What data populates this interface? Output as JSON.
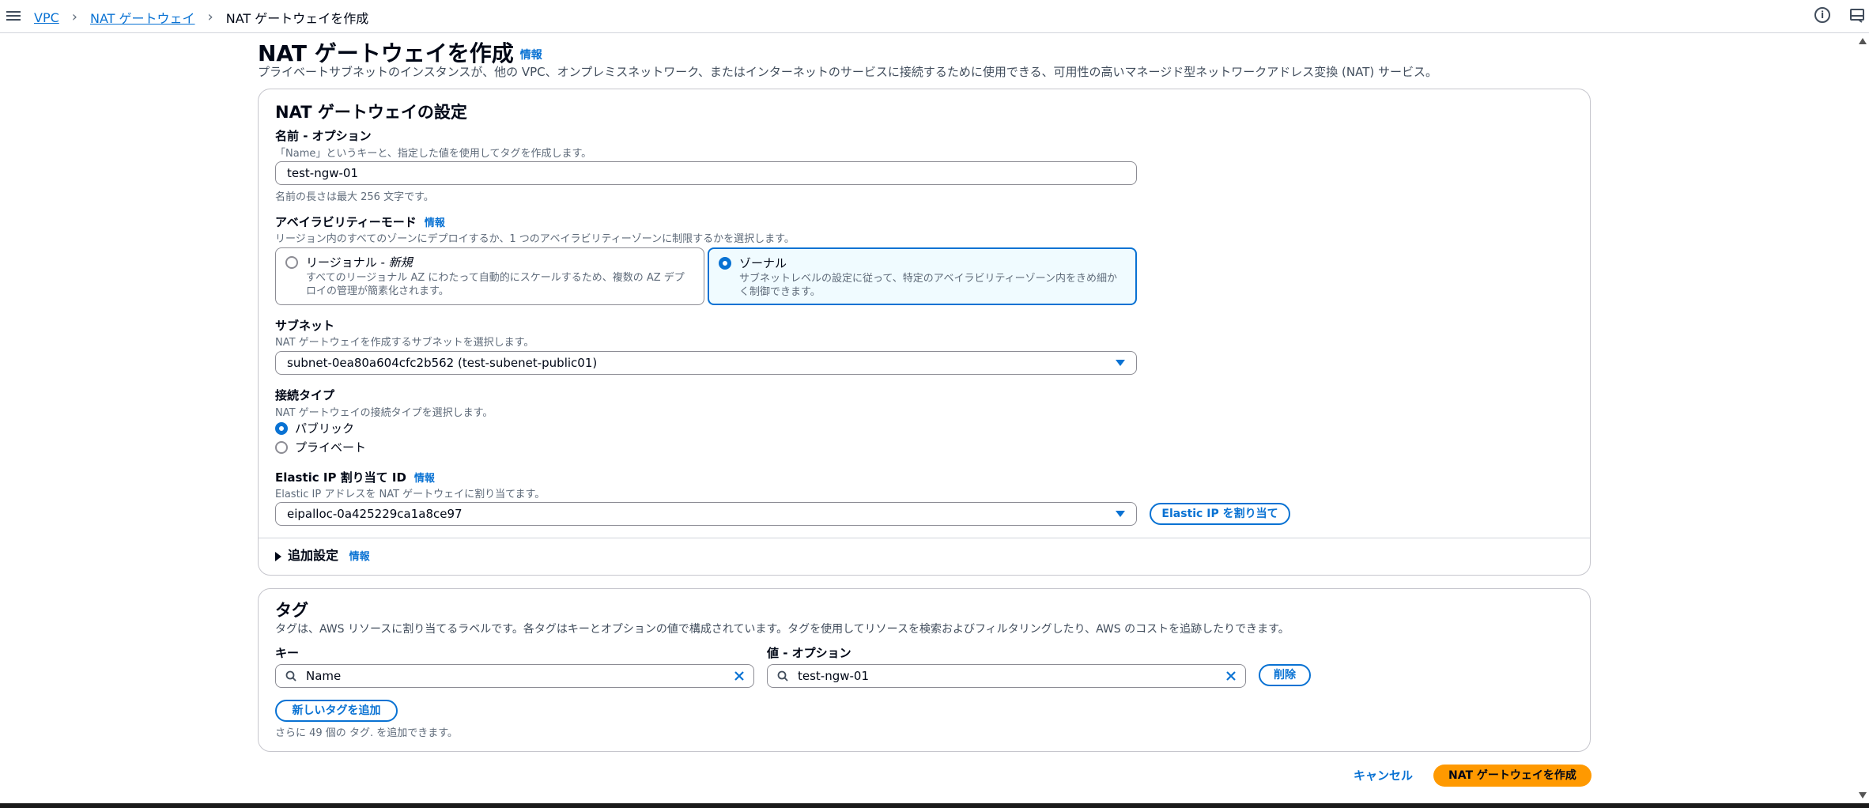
{
  "breadcrumb": {
    "items": [
      "VPC",
      "NAT ゲートウェイ"
    ],
    "current": "NAT ゲートウェイを作成"
  },
  "page": {
    "title": "NAT ゲートウェイを作成",
    "info_label": "情報",
    "description": "プライベートサブネットのインスタンスが、他の VPC、オンプレミスネットワーク、またはインターネットのサービスに接続するために使用できる、可用性の高いマネージド型ネットワークアドレス変換 (NAT) サービス。"
  },
  "settings": {
    "title": "NAT ゲートウェイの設定",
    "name": {
      "label": "名前 - オプション",
      "hint": "「Name」というキーと、指定した値を使用してタグを作成します。",
      "value": "test-ngw-01",
      "constraint": "名前の長さは最大 256 文字です。"
    },
    "availability": {
      "label": "アベイラビリティーモード",
      "info": "情報",
      "hint": "リージョン内のすべてのゾーンにデプロイするか、1 つのアベイラビリティーゾーンに制限するかを選択します。",
      "regional": {
        "title": "リージョナル - ",
        "badge": "新規",
        "desc": "すべてのリージョナル AZ にわたって自動的にスケールするため、複数の AZ デプロイの管理が簡素化されます。"
      },
      "zonal": {
        "title": "ゾーナル",
        "desc": "サブネットレベルの設定に従って、特定のアベイラビリティーゾーン内をきめ細かく制御できます。"
      }
    },
    "subnet": {
      "label": "サブネット",
      "hint": "NAT ゲートウェイを作成するサブネットを選択します。",
      "value": "subnet-0ea80a604cfc2b562 (test-subenet-public01)"
    },
    "connectivity": {
      "label": "接続タイプ",
      "hint": "NAT ゲートウェイの接続タイプを選択します。",
      "options": [
        "パブリック",
        "プライベート"
      ]
    },
    "eip": {
      "label": "Elastic IP 割り当て ID",
      "info": "情報",
      "hint": "Elastic IP アドレスを NAT ゲートウェイに割り当てます。",
      "value": "eipalloc-0a425229ca1a8ce97",
      "allocate_button": "Elastic IP を割り当て"
    },
    "additional": {
      "label": "追加設定",
      "info": "情報"
    }
  },
  "tags": {
    "title": "タグ",
    "description": "タグは、AWS リソースに割り当てるラベルです。各タグはキーとオプションの値で構成されています。タグを使用してリソースを検索およびフィルタリングしたり、AWS のコストを追跡したりできます。",
    "key_label": "キー",
    "value_label": "値 - オプション",
    "key_value": "Name",
    "value_value": "test-ngw-01",
    "remove_button": "削除",
    "add_button": "新しいタグを追加",
    "remaining": "さらに 49 個の タグ. を追加できます。"
  },
  "footer": {
    "cancel": "キャンセル",
    "create": "NAT ゲートウェイを作成"
  }
}
